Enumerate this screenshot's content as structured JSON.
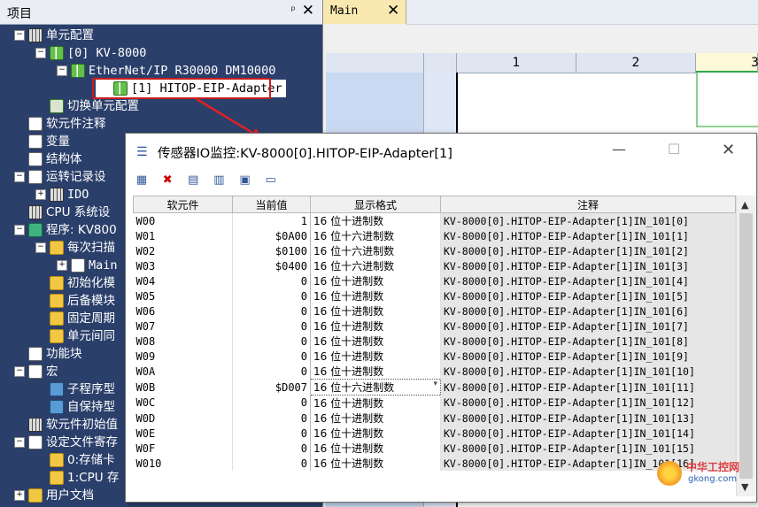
{
  "left_panel": {
    "title": "项目",
    "pin": "ᵖ",
    "close": "✕",
    "tree": [
      {
        "label": "单元配置",
        "level": 0,
        "toggle": "−",
        "icon": "unit-config-icon"
      },
      {
        "label": "[0]  KV-8000",
        "level": 1,
        "toggle": "−",
        "icon": "plc-icon"
      },
      {
        "label": "EtherNet/IP   R30000  DM10000",
        "level": 2,
        "toggle": "−",
        "icon": "ethernet-icon"
      },
      {
        "label": "[1]  HITOP-EIP-Adapter",
        "level": 3,
        "toggle": "",
        "icon": "adapter-icon"
      },
      {
        "label": "切换单元配置",
        "level": 1,
        "toggle": "",
        "icon": "switch-icon"
      },
      {
        "label": "软元件注释",
        "level": 0,
        "toggle": "",
        "icon": "comment-icon"
      },
      {
        "label": "变量",
        "level": 0,
        "toggle": "",
        "icon": "variable-icon"
      },
      {
        "label": "结构体",
        "level": 0,
        "toggle": "",
        "icon": "struct-icon"
      },
      {
        "label": "运转记录设",
        "level": 0,
        "toggle": "−",
        "icon": "log-icon"
      },
      {
        "label": "IDO",
        "level": 1,
        "toggle": "+",
        "icon": "ido-icon"
      },
      {
        "label": "CPU 系统设",
        "level": 0,
        "toggle": "",
        "icon": "cpu-icon"
      },
      {
        "label": "程序: KV800",
        "level": 0,
        "toggle": "−",
        "icon": "program-icon"
      },
      {
        "label": "每次扫描",
        "level": 1,
        "toggle": "−",
        "icon": "folder-icon"
      },
      {
        "label": "Main",
        "level": 2,
        "toggle": "+",
        "icon": "main-icon"
      },
      {
        "label": "初始化模",
        "level": 1,
        "toggle": "",
        "icon": "folder-icon"
      },
      {
        "label": "后备模块",
        "level": 1,
        "toggle": "",
        "icon": "folder-icon"
      },
      {
        "label": "固定周期",
        "level": 1,
        "toggle": "",
        "icon": "folder-icon"
      },
      {
        "label": "单元间同",
        "level": 1,
        "toggle": "",
        "icon": "folder-icon"
      },
      {
        "label": "功能块",
        "level": 0,
        "toggle": "",
        "icon": "function-block-icon"
      },
      {
        "label": "宏",
        "level": 0,
        "toggle": "−",
        "icon": "macro-icon"
      },
      {
        "label": "子程序型",
        "level": 1,
        "toggle": "",
        "icon": "subroutine-icon"
      },
      {
        "label": "自保持型",
        "level": 1,
        "toggle": "",
        "icon": "selfhold-icon"
      },
      {
        "label": "软元件初始值",
        "level": 0,
        "toggle": "",
        "icon": "init-icon"
      },
      {
        "label": "设定文件寄存",
        "level": 0,
        "toggle": "−",
        "icon": "file-register-icon"
      },
      {
        "label": "0:存储卡",
        "level": 1,
        "toggle": "",
        "icon": "folder-icon"
      },
      {
        "label": "1:CPU 存",
        "level": 1,
        "toggle": "",
        "icon": "folder-icon"
      },
      {
        "label": "用户文档",
        "level": 0,
        "toggle": "+",
        "icon": "user-doc-icon"
      }
    ]
  },
  "editor": {
    "tab_label": "Main",
    "tab_close": "✕",
    "columns": [
      "1",
      "2",
      "3"
    ]
  },
  "dialog": {
    "title": "传感器IO监控:KV-8000[0].HITOP-EIP-Adapter[1]",
    "minimize": "—",
    "maximize": "☐",
    "close": "✕",
    "headers": [
      "软元件",
      "当前值",
      "显示格式",
      "注释"
    ],
    "rows": [
      {
        "device": "W00",
        "value": "1",
        "format": "16 位十进制数",
        "comment": "KV-8000[0].HITOP-EIP-Adapter[1]IN_101[0]"
      },
      {
        "device": "W01",
        "value": "$0A00",
        "format": "16 位十六进制数",
        "comment": "KV-8000[0].HITOP-EIP-Adapter[1]IN_101[1]"
      },
      {
        "device": "W02",
        "value": "$0100",
        "format": "16 位十六进制数",
        "comment": "KV-8000[0].HITOP-EIP-Adapter[1]IN_101[2]"
      },
      {
        "device": "W03",
        "value": "$0400",
        "format": "16 位十六进制数",
        "comment": "KV-8000[0].HITOP-EIP-Adapter[1]IN_101[3]"
      },
      {
        "device": "W04",
        "value": "0",
        "format": "16 位十进制数",
        "comment": "KV-8000[0].HITOP-EIP-Adapter[1]IN_101[4]"
      },
      {
        "device": "W05",
        "value": "0",
        "format": "16 位十进制数",
        "comment": "KV-8000[0].HITOP-EIP-Adapter[1]IN_101[5]"
      },
      {
        "device": "W06",
        "value": "0",
        "format": "16 位十进制数",
        "comment": "KV-8000[0].HITOP-EIP-Adapter[1]IN_101[6]"
      },
      {
        "device": "W07",
        "value": "0",
        "format": "16 位十进制数",
        "comment": "KV-8000[0].HITOP-EIP-Adapter[1]IN_101[7]"
      },
      {
        "device": "W08",
        "value": "0",
        "format": "16 位十进制数",
        "comment": "KV-8000[0].HITOP-EIP-Adapter[1]IN_101[8]"
      },
      {
        "device": "W09",
        "value": "0",
        "format": "16 位十进制数",
        "comment": "KV-8000[0].HITOP-EIP-Adapter[1]IN_101[9]"
      },
      {
        "device": "W0A",
        "value": "0",
        "format": "16 位十进制数",
        "comment": "KV-8000[0].HITOP-EIP-Adapter[1]IN_101[10]"
      },
      {
        "device": "W0B",
        "value": "$D007",
        "format": "16 位十六进制数",
        "comment": "KV-8000[0].HITOP-EIP-Adapter[1]IN_101[11]"
      },
      {
        "device": "W0C",
        "value": "0",
        "format": "16 位十进制数",
        "comment": "KV-8000[0].HITOP-EIP-Adapter[1]IN_101[12]"
      },
      {
        "device": "W0D",
        "value": "0",
        "format": "16 位十进制数",
        "comment": "KV-8000[0].HITOP-EIP-Adapter[1]IN_101[13]"
      },
      {
        "device": "W0E",
        "value": "0",
        "format": "16 位十进制数",
        "comment": "KV-8000[0].HITOP-EIP-Adapter[1]IN_101[14]"
      },
      {
        "device": "W0F",
        "value": "0",
        "format": "16 位十进制数",
        "comment": "KV-8000[0].HITOP-EIP-Adapter[1]IN_101[15]"
      },
      {
        "device": "W010",
        "value": "0",
        "format": "16 位十进制数",
        "comment": "KV-8000[0].HITOP-EIP-Adapter[1]IN_101[16]"
      }
    ],
    "selected_row": 11
  },
  "watermark": {
    "line1": "中华工控网",
    "line2": "gkong.com"
  },
  "colors": {
    "panel_bg": "#2b3f6b",
    "callout": "#c81e1e",
    "tab_active": "#f9e9b0"
  }
}
